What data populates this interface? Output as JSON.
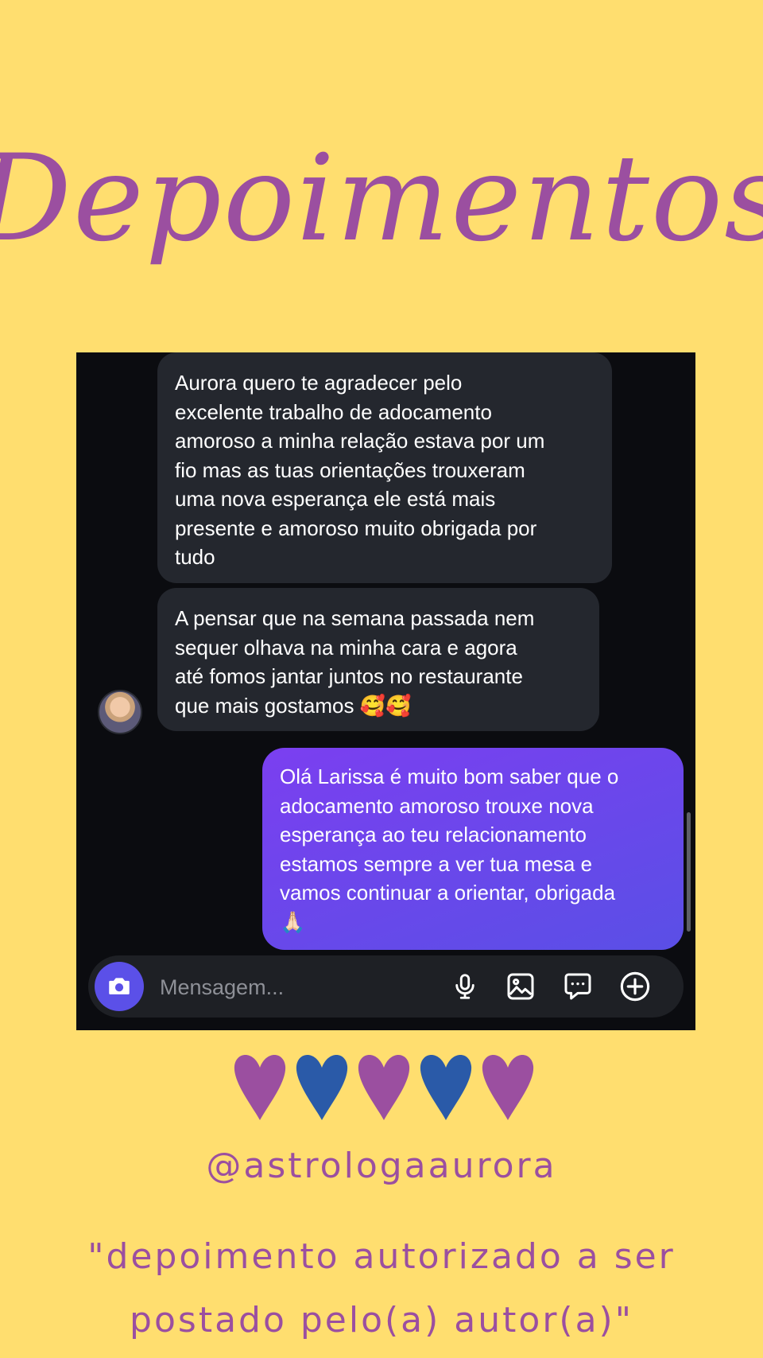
{
  "title": "Depoimentos",
  "messages": [
    {
      "direction": "incoming",
      "text": "Aurora quero te agradecer pelo\nexcelente trabalho de adocamento\namoroso a minha relação estava por um\nfio mas as tuas orientações trouxeram\numa nova esperança ele está mais\npresente e amoroso muito obrigada por\ntudo"
    },
    {
      "direction": "incoming",
      "text": "A pensar que na semana passada nem\nsequer olhava na minha cara e agora\naté fomos jantar juntos no restaurante\nque mais gostamos 🥰🥰"
    },
    {
      "direction": "outgoing",
      "text": "Olá Larissa é muito bom saber que o\nadocamento amoroso trouxe nova\nesperança ao teu relacionamento\nestamos sempre a ver tua mesa e\nvamos continuar a orientar, obrigada\n🙏🏻"
    }
  ],
  "composer": {
    "placeholder": "Mensagem...",
    "icons": [
      "camera-icon",
      "microphone-icon",
      "gallery-icon",
      "sticker-icon",
      "plus-icon"
    ]
  },
  "hearts": [
    "#9b4fa0",
    "#2a5aa8",
    "#9b4fa0",
    "#2a5aa8",
    "#9b4fa0"
  ],
  "handle": "@astrologaaurora",
  "note": "\"depoimento autorizado a ser\npostado pelo(a) autor(a)\"",
  "colors": {
    "background": "#ffde6f",
    "accent": "#9b4fa0",
    "outgoing_bubble": "#6a48ec",
    "incoming_bubble": "#24272e"
  }
}
